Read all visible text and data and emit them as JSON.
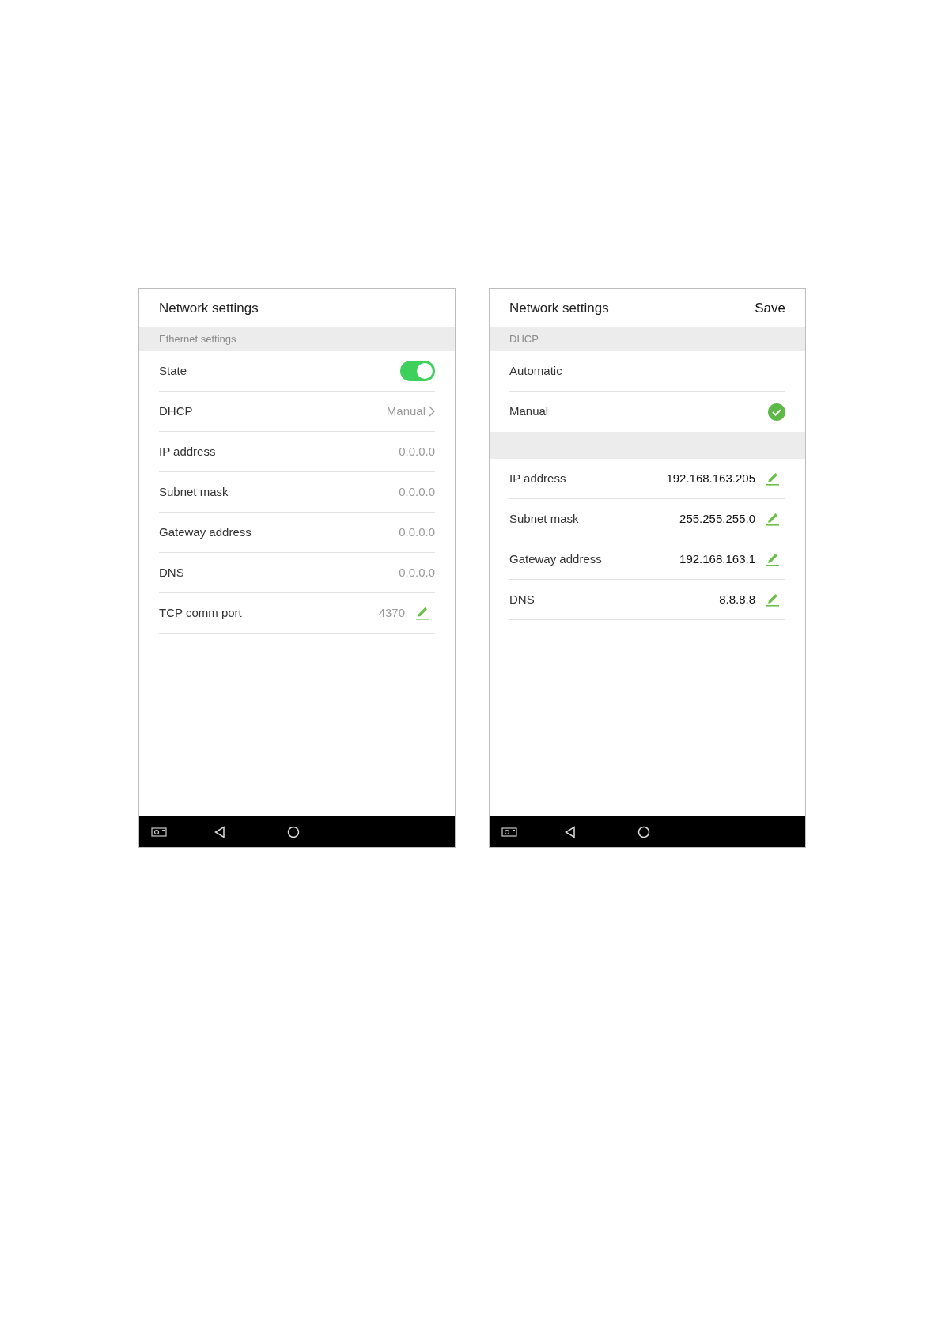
{
  "screens": [
    {
      "title": "Network settings",
      "section": "Ethernet settings",
      "rows": [
        {
          "kind": "toggle",
          "label": "State",
          "on": true
        },
        {
          "kind": "link",
          "label": "DHCP",
          "value": "Manual"
        },
        {
          "kind": "value",
          "label": "IP address",
          "value": "0.0.0.0",
          "disabled": true
        },
        {
          "kind": "value",
          "label": "Subnet mask",
          "value": "0.0.0.0",
          "disabled": true
        },
        {
          "kind": "value",
          "label": "Gateway address",
          "value": "0.0.0.0",
          "disabled": true
        },
        {
          "kind": "value",
          "label": "DNS",
          "value": "0.0.0.0",
          "disabled": true
        },
        {
          "kind": "edit",
          "label": "TCP comm port",
          "value": "4370",
          "disabled": true
        }
      ]
    },
    {
      "title": "Network settings",
      "action": "Save",
      "section": "DHCP",
      "rows": [
        {
          "kind": "option",
          "label": "Automatic",
          "selected": false
        },
        {
          "kind": "option",
          "label": "Manual",
          "selected": true
        },
        {
          "kind": "spacer"
        },
        {
          "kind": "edit",
          "label": "IP address",
          "value": "192.168.163.205",
          "disabled": false
        },
        {
          "kind": "edit",
          "label": "Subnet mask",
          "value": "255.255.255.0",
          "disabled": false
        },
        {
          "kind": "edit",
          "label": "Gateway address",
          "value": "192.168.163.1",
          "disabled": false
        },
        {
          "kind": "edit",
          "label": "DNS",
          "value": "8.8.8.8",
          "disabled": false
        }
      ]
    }
  ]
}
